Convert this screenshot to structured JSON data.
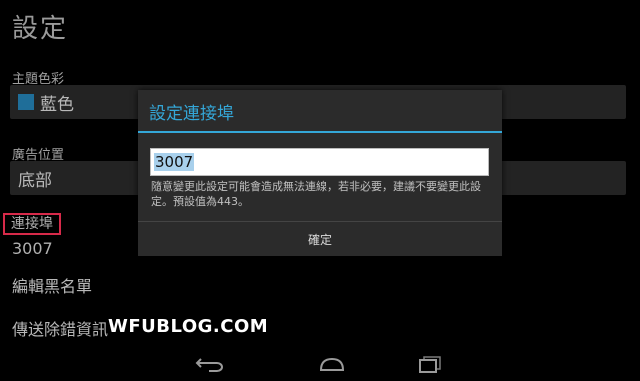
{
  "page": {
    "title": "設定"
  },
  "theme": {
    "label": "主題色彩",
    "value": "藍色",
    "swatch_color": "#1f6e99"
  },
  "ad_position": {
    "label": "廣告位置",
    "value": "底部"
  },
  "port": {
    "label": "連接埠",
    "value": "3007"
  },
  "blacklist": {
    "label": "編輯黑名單"
  },
  "debug": {
    "label": "傳送除錯資訊"
  },
  "watermark": {
    "text": "WFUBLOG.COM"
  },
  "dialog": {
    "title": "設定連接埠",
    "input_value": "3007",
    "message": "隨意變更此設定可能會造成無法連線，若非必要，建議不要變更此設定。預設值為443。",
    "ok_label": "確定",
    "accent_color": "#34a7d8"
  },
  "navbar": {
    "back_icon": "back-icon",
    "home_icon": "home-icon",
    "recents_icon": "recents-icon"
  }
}
